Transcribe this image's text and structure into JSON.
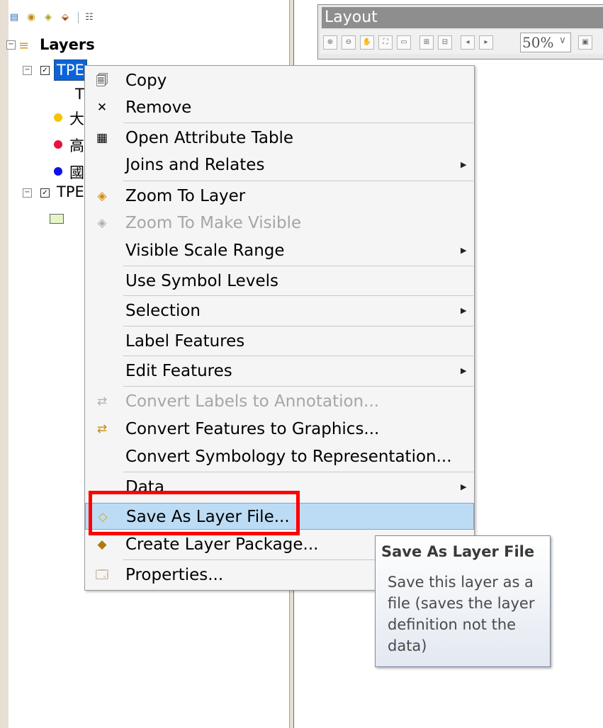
{
  "toc": {
    "root_label": "Layers",
    "layers": [
      {
        "name": "TPE",
        "sublabel": "T"
      },
      {
        "name": "TPE"
      }
    ],
    "legend": [
      {
        "label": "大",
        "color": "#f5c400"
      },
      {
        "label": "高",
        "color": "#e8123c"
      },
      {
        "label": "國",
        "color": "#1010e8"
      }
    ],
    "polygon_swatch_color": "#e6f5c8"
  },
  "layout": {
    "title": "Layout",
    "zoom": "50%"
  },
  "context_menu": {
    "items": [
      {
        "label": "Copy",
        "icon": "copy-icon",
        "enabled": true
      },
      {
        "label": "Remove",
        "icon": "remove-icon",
        "enabled": true
      },
      {
        "label": "Open Attribute Table",
        "icon": "table-icon",
        "enabled": true
      },
      {
        "label": "Joins and Relates",
        "enabled": true,
        "submenu": true
      },
      {
        "label": "Zoom To Layer",
        "icon": "zoom-to-layer-icon",
        "enabled": true
      },
      {
        "label": "Zoom To Make Visible",
        "icon": "zoom-visible-icon",
        "enabled": false
      },
      {
        "label": "Visible Scale Range",
        "enabled": true,
        "submenu": true
      },
      {
        "label": "Use Symbol Levels",
        "enabled": true
      },
      {
        "label": "Selection",
        "enabled": true,
        "submenu": true
      },
      {
        "label": "Label Features",
        "enabled": true
      },
      {
        "label": "Edit Features",
        "enabled": true,
        "submenu": true
      },
      {
        "label": "Convert Labels to Annotation...",
        "icon": "convert-labels-icon",
        "enabled": false
      },
      {
        "label": "Convert Features to Graphics...",
        "icon": "convert-graphics-icon",
        "enabled": true
      },
      {
        "label": "Convert Symbology to Representation...",
        "enabled": true
      },
      {
        "label": "Data",
        "enabled": true,
        "submenu": true
      },
      {
        "label": "Save As Layer File...",
        "icon": "save-layer-icon",
        "enabled": true,
        "highlighted": true
      },
      {
        "label": "Create Layer Package...",
        "icon": "package-icon",
        "enabled": true
      },
      {
        "label": "Properties...",
        "icon": "properties-icon",
        "enabled": true
      }
    ]
  },
  "tooltip": {
    "title": "Save As Layer File",
    "body": "Save this layer as a file (saves the layer definition not the data)"
  },
  "colors": {
    "highlight": "#bcdcf5",
    "annotation_box": "#ff0000",
    "selected_layer": "#0a64d8"
  }
}
